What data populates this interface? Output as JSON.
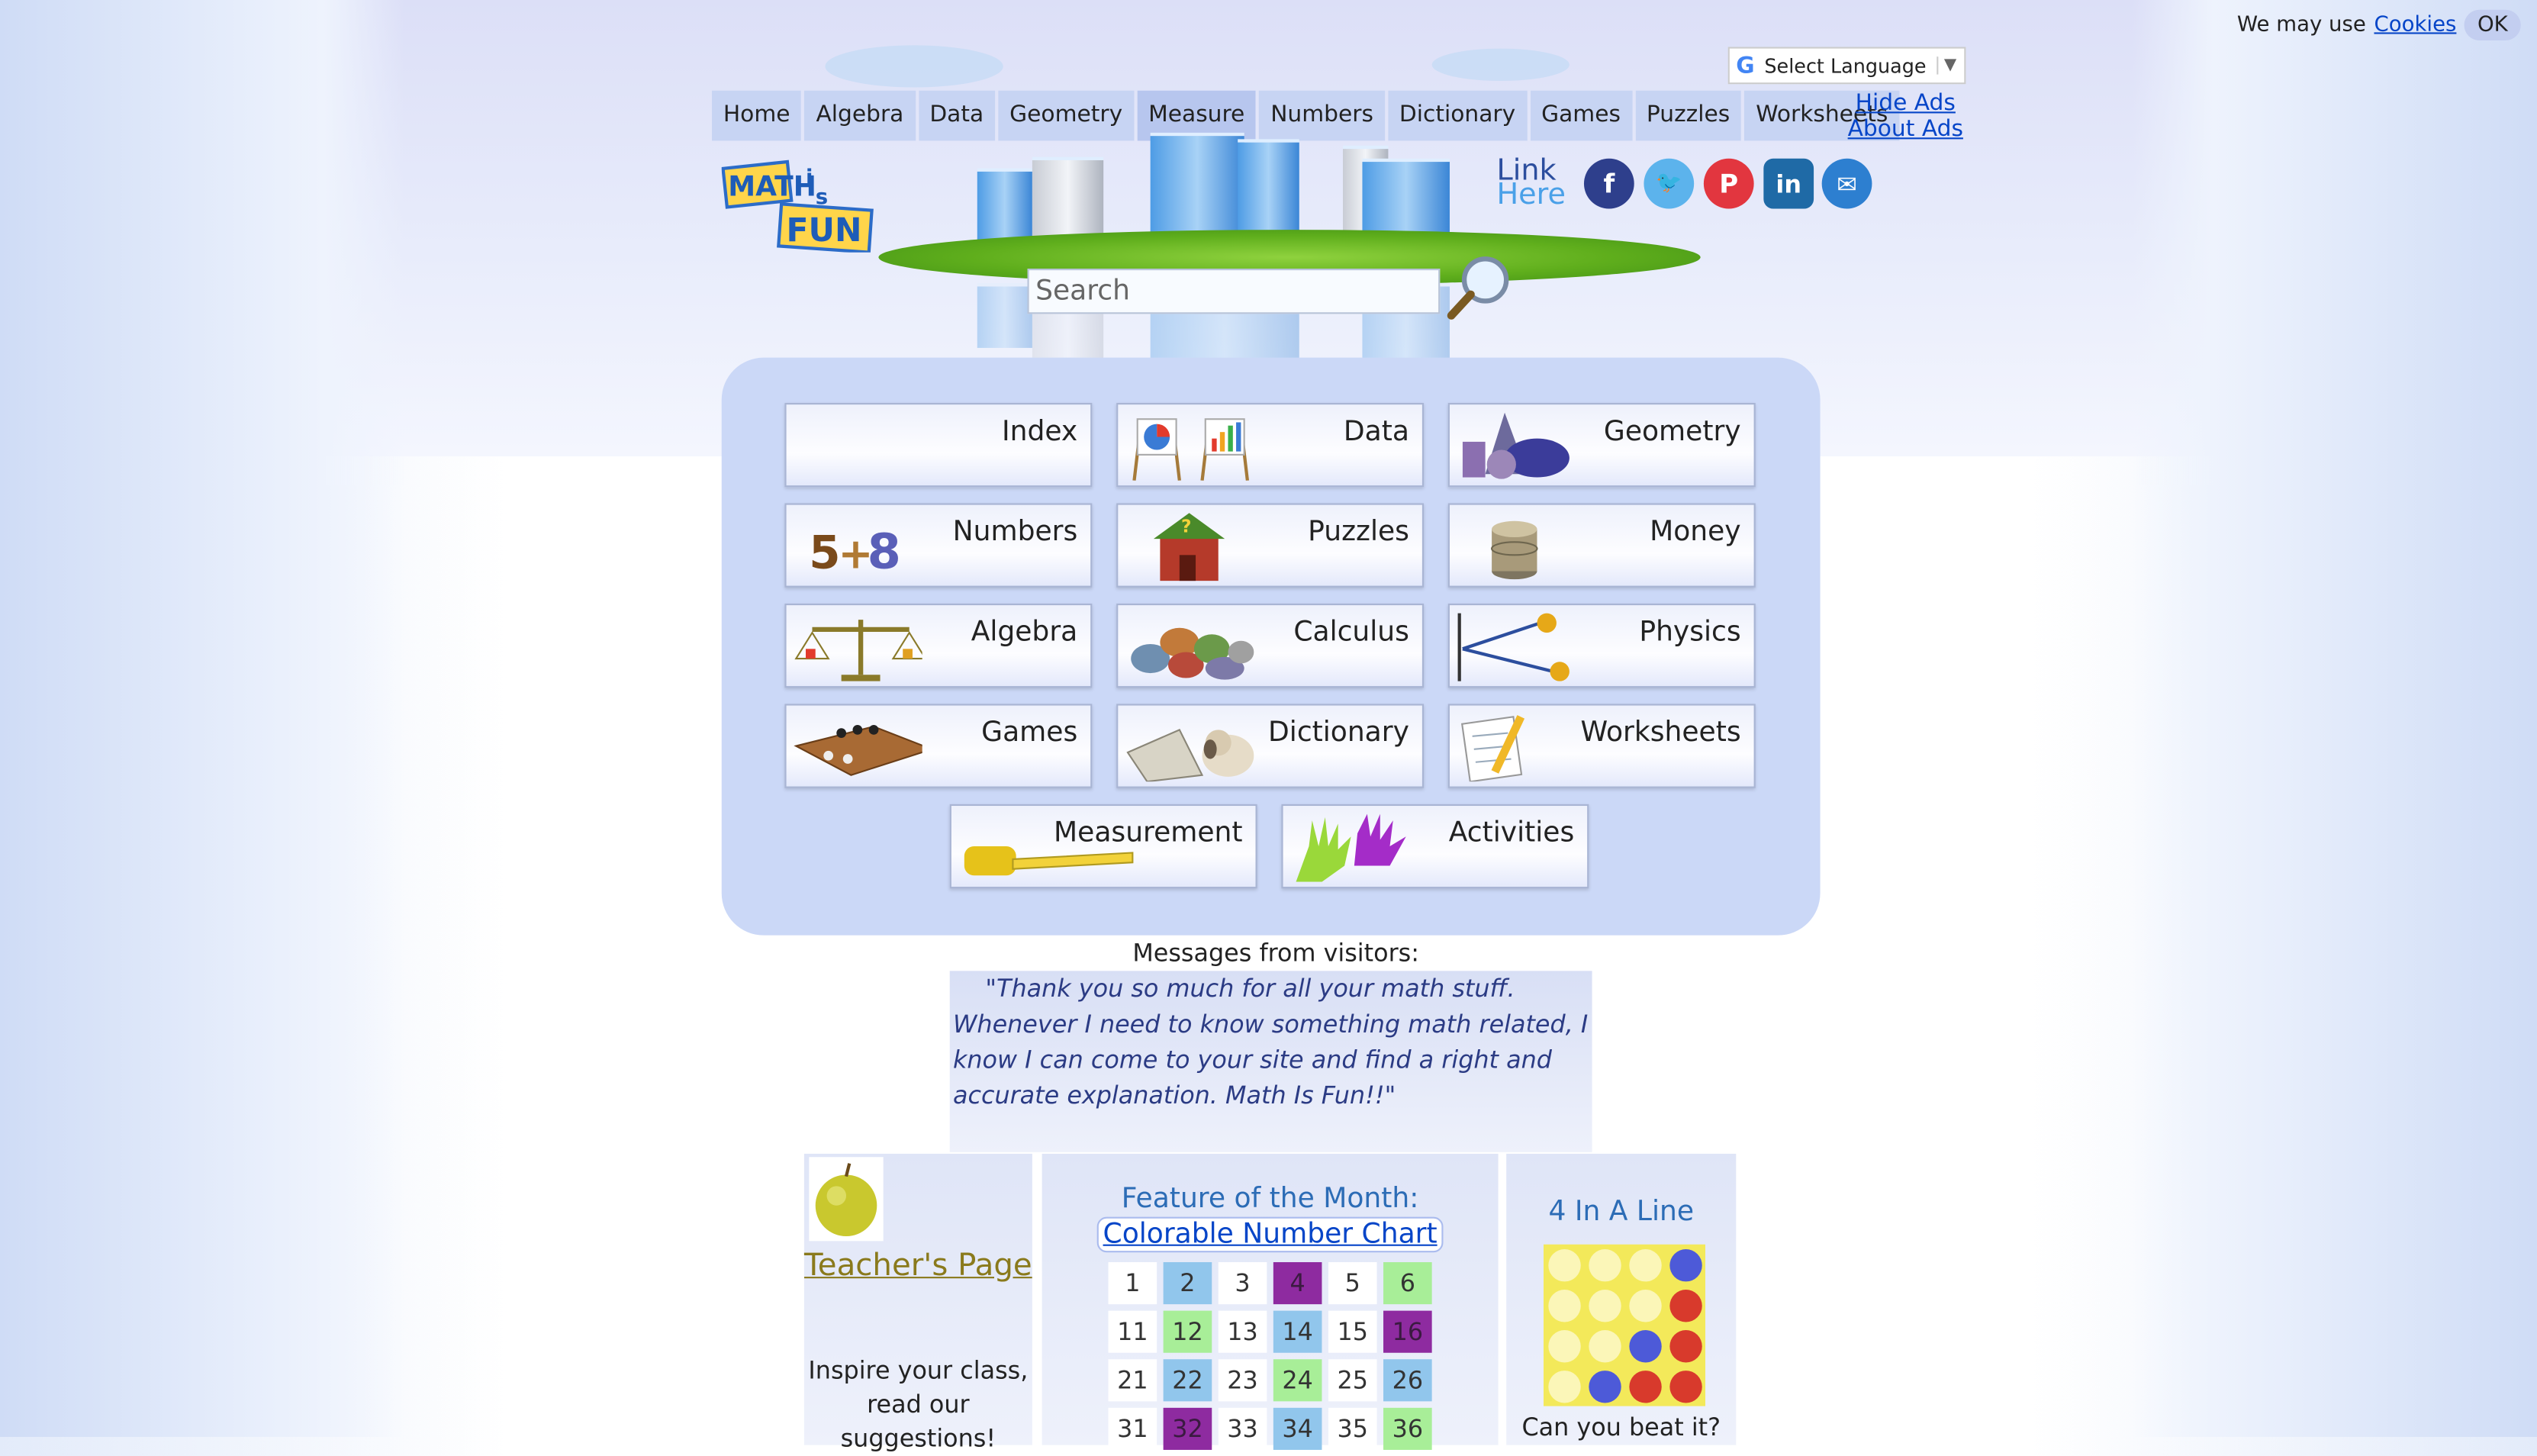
{
  "cookie": {
    "text": "We may use",
    "link": "Cookies",
    "ok": "OK"
  },
  "language": {
    "label": "Select Language"
  },
  "nav": {
    "items": [
      "Home",
      "Algebra",
      "Data",
      "Geometry",
      "Measure",
      "Numbers",
      "Dictionary",
      "Games",
      "Puzzles",
      "Worksheets"
    ],
    "active": "Measure"
  },
  "ads": {
    "hide": "Hide Ads",
    "about": "About Ads"
  },
  "logo": {
    "text": "MATH is FUN"
  },
  "link_here": {
    "line1": "Link",
    "line2": "Here"
  },
  "search": {
    "placeholder": "Search"
  },
  "tiles": {
    "index": "Index",
    "data": "Data",
    "geometry": "Geometry",
    "numbers": "Numbers",
    "puzzles": "Puzzles",
    "money": "Money",
    "algebra": "Algebra",
    "calculus": "Calculus",
    "physics": "Physics",
    "games": "Games",
    "dictionary": "Dictionary",
    "worksheets": "Worksheets",
    "measurement": "Measurement",
    "activities": "Activities"
  },
  "messages": {
    "title": "Messages from visitors:",
    "quote": "\"Thank you so much for all your math stuff. Whenever I need to know something math related, I know I can come to your site and find a right and accurate explanation. Math Is Fun!!\""
  },
  "teacher": {
    "link": "Teacher's Page",
    "line1": "Inspire your class,",
    "line2": "read our",
    "line3": "suggestions!"
  },
  "feature": {
    "title": "Feature of the Month:",
    "link": "Colorable Number Chart",
    "rows": [
      [
        "1",
        "2",
        "3",
        "4",
        "5",
        "6"
      ],
      [
        "11",
        "12",
        "13",
        "14",
        "15",
        "16"
      ],
      [
        "21",
        "22",
        "23",
        "24",
        "25",
        "26"
      ],
      [
        "31",
        "32",
        "33",
        "34",
        "35",
        "36"
      ]
    ]
  },
  "four_in_line": {
    "title": "4 In A Line",
    "tagline": "Can you beat it?"
  },
  "colors": {
    "panel": "#cbd8f7",
    "nav": "#c7d4f3",
    "link": "#0645c8",
    "quote": "#2b3b84"
  }
}
